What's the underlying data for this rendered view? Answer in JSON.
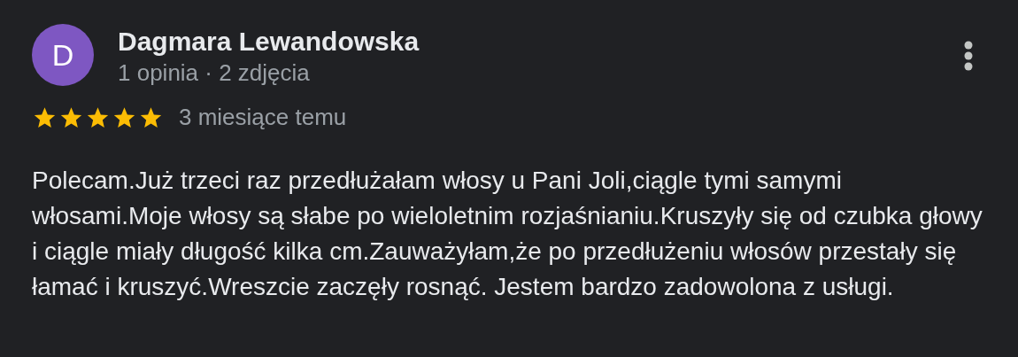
{
  "review": {
    "avatar_letter": "D",
    "author": "Dagmara Lewandowska",
    "meta": "1 opinia · 2 zdjęcia",
    "stars": 5,
    "time": "3 miesiące temu",
    "text": "Polecam.Już trzeci raz przedłużałam włosy u Pani Joli,ciągle tymi samymi włosami.Moje włosy są słabe po wieloletnim rozjaśnianiu.Kruszyły się od czubka głowy i ciągle miały długość kilka cm.Zauważyłam,że po przedłużeniu włosów przestały się łamać i kruszyć.Wreszcie zaczęły rosnąć. Jestem bardzo zadowolona z usługi."
  }
}
